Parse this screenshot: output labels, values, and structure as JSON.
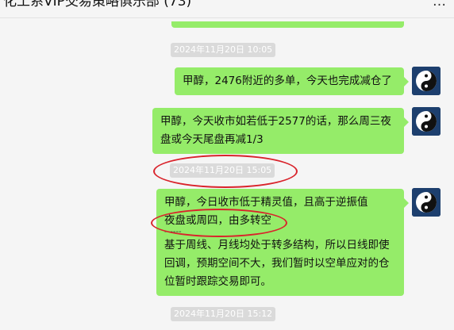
{
  "header": {
    "title": "化工系VIP交易策略俱乐部 (73)",
    "more_icon": "more-dots-icon"
  },
  "messages": [
    {
      "timestamp": "2024年11月20日 10:05"
    },
    {
      "text": "甲醇，2476附近的多单，今天也完成减仓了"
    },
    {
      "text": "甲醇，今天收市如若低于2577的话，那么周三夜盘或今天尾盘再减1/3"
    },
    {
      "timestamp": "2024年11月20日 15:05"
    },
    {
      "text_line1": "甲醇，今日收市低于精灵值，且高于逆振值",
      "text_line2": "夜盘或周四，由多转空",
      "separator": "------",
      "text_para2": "基于周线、月线均处于转多结构，所以日线即使回调，预期空间不大，我们暂时以空单应对的仓位暂时跟踪交易即可。"
    },
    {
      "timestamp": "2024年11月20日 15:12"
    }
  ],
  "avatar_icon": "yin-yang-icon",
  "colors": {
    "bubble": "#95ec69",
    "annotation": "#d9232b",
    "background": "#f5f5f5"
  }
}
